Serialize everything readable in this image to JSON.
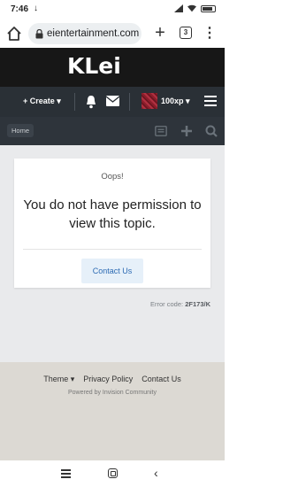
{
  "status_bar": {
    "time": "7:46",
    "download_glyph": "↓"
  },
  "browser": {
    "url": "eientertainment.com",
    "tab_count": "3",
    "new_tab_glyph": "+",
    "more_glyph": "⋮"
  },
  "header": {
    "logo": "KLei",
    "create_label": "+ Create ▾",
    "xp_label": "100xp ▾"
  },
  "breadcrumb": {
    "home_label": "Home"
  },
  "error_card": {
    "oops": "Oops!",
    "message": "You do not have permission to view this topic.",
    "contact_label": "Contact Us"
  },
  "error_code": {
    "label": "Error code:",
    "code": "2F173/K"
  },
  "footer": {
    "theme_label": "Theme ▾",
    "privacy_label": "Privacy Policy",
    "contact_label": "Contact Us",
    "powered_by": "Powered by Invision Community"
  },
  "colors": {
    "header_bg": "#171717",
    "userbar_bg": "#2a3036",
    "accent_link": "#2d6bb3",
    "content_bg": "#e9eaec",
    "footer_bg": "#dcd9d3"
  }
}
